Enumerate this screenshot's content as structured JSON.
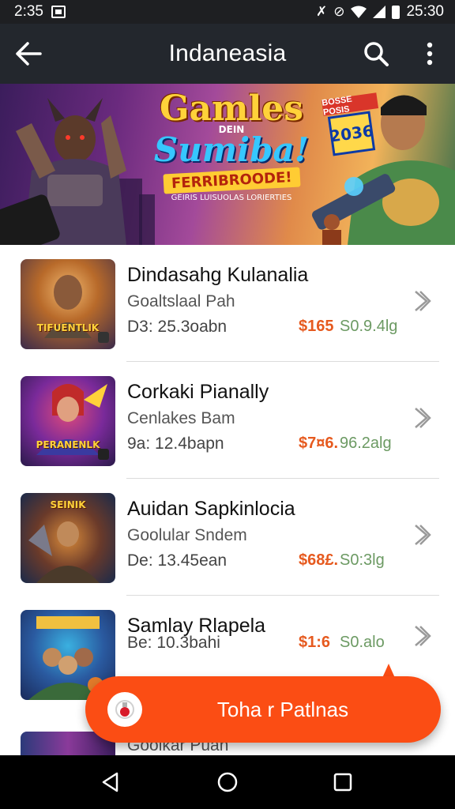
{
  "status_bar": {
    "time": "2:35",
    "clock_right": "25:30",
    "app_icon": "M"
  },
  "app_bar": {
    "title": "Indaneasia"
  },
  "banner": {
    "line1": "Gamles",
    "line2": "DEIN",
    "line3": "Sumiba!",
    "line4": "FERRIBROODE!",
    "line5": "GEIRIS LUISUOLAS LORIERTIES",
    "badge_top": "BOSSE POSIS",
    "badge_year": "2036"
  },
  "list_items": [
    {
      "title": "Dindasahg Kulanalia",
      "subtitle": "Goaltslaal Pah",
      "meta": "D3: 25.3oabn",
      "price": "$165",
      "price_alt": "S0.9.4lg",
      "thumb_label": "TIFUENTLIK"
    },
    {
      "title": "Corkaki Pianally",
      "subtitle": "Cenlakes Bam",
      "meta": "9a: 12.4bapn",
      "price": "$7¤6.",
      "price_alt": "96.2alg",
      "thumb_label": "PERANENLK"
    },
    {
      "title": "Auidan Sapkinlocia",
      "subtitle": "Goolular Sndem",
      "meta": "De: 13.45ean",
      "price": "$68£.",
      "price_alt": "S0:3lg",
      "thumb_label": "SEINIK"
    },
    {
      "title": "Samlay Rlapela",
      "subtitle": "",
      "meta": "Be: 10.3bahi",
      "price": "$1:6",
      "price_alt": "S0.alo",
      "thumb_label": ""
    }
  ],
  "partial_item": {
    "subtitle": "Goolkar Puan"
  },
  "fab": {
    "label": "Toha r Patlnas"
  },
  "colors": {
    "accent": "#fb4d14",
    "appbar": "#23272d",
    "price": "#e65a1f",
    "price_alt": "#6c9a63"
  }
}
